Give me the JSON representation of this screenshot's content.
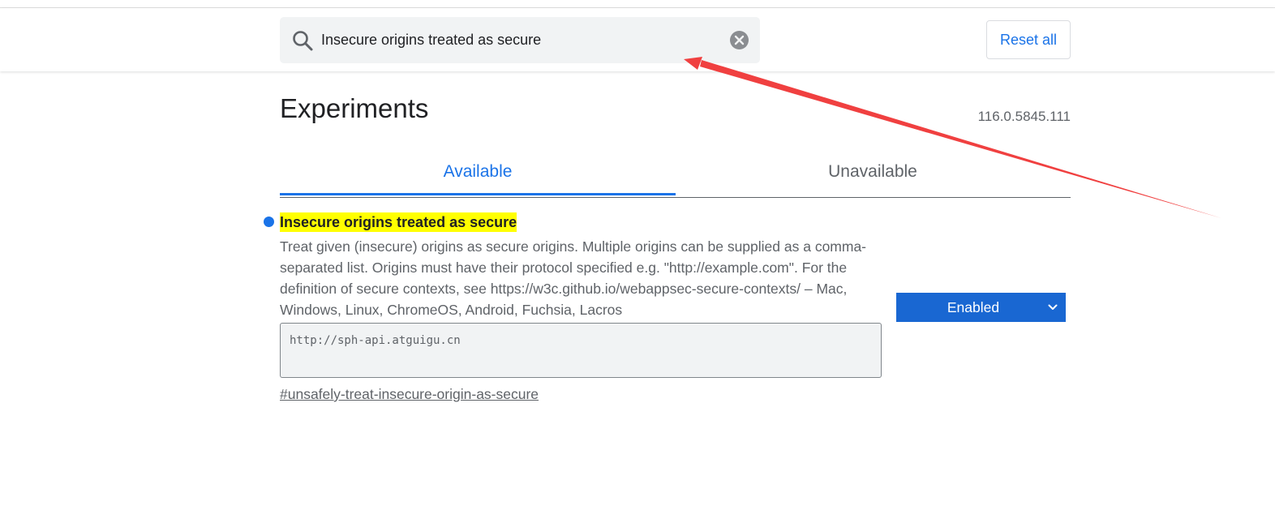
{
  "search": {
    "value": "Insecure origins treated as secure",
    "icon": "search-icon",
    "clear_icon": "close-icon"
  },
  "header": {
    "reset_label": "Reset all"
  },
  "page": {
    "title": "Experiments",
    "version": "116.0.5845.111"
  },
  "tabs": [
    {
      "label": "Available",
      "selected": true
    },
    {
      "label": "Unavailable",
      "selected": false
    }
  ],
  "experiment": {
    "title": "Insecure origins treated as secure",
    "description": "Treat given (insecure) origins as secure origins. Multiple origins can be supplied as a comma-separated list. Origins must have their protocol specified e.g. \"http://example.com\". For the definition of secure contexts, see https://w3c.github.io/webappsec-secure-contexts/ – Mac, Windows, Linux, ChromeOS, Android, Fuchsia, Lacros",
    "origins_value": "http://sph-api.atguigu.cn",
    "link": "#unsafely-treat-insecure-origin-as-secure",
    "state": "Enabled",
    "highlight_color": "#ffff00"
  },
  "colors": {
    "accent": "#1a73e8",
    "select_bg": "#1967d2",
    "annotation_arrow": "#f04040"
  }
}
